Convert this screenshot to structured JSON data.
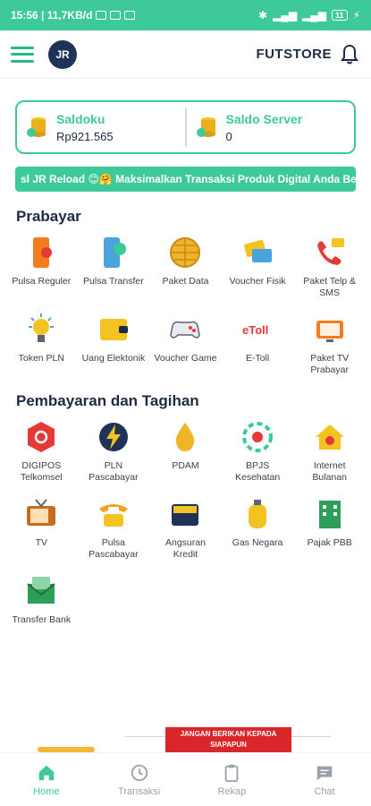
{
  "status": {
    "left": "15:56 | 11,7KB/d",
    "battery": "11"
  },
  "header": {
    "logo_text": "JR",
    "store_name": "FUTSTORE"
  },
  "balance": [
    {
      "label": "Saldoku",
      "value": "Rp921.565"
    },
    {
      "label": "Saldo Server",
      "value": "0"
    }
  ],
  "marquee": "sl JR Reload 😊🤗 Maksimalkan Transaksi Produk Digital Anda Bers",
  "prabayar": {
    "title": "Prabayar",
    "items": [
      {
        "label": "Pulsa Reguler"
      },
      {
        "label": "Pulsa Transfer"
      },
      {
        "label": "Paket Data"
      },
      {
        "label": "Voucher Fisik"
      },
      {
        "label": "Paket Telp & SMS"
      },
      {
        "label": "Token PLN"
      },
      {
        "label": "Uang Elektonik"
      },
      {
        "label": "Voucher Game"
      },
      {
        "label": "E-Toll"
      },
      {
        "label": "Paket TV Prabayar"
      }
    ]
  },
  "pembayaran": {
    "title": "Pembayaran dan Tagihan",
    "items": [
      {
        "label": "DIGIPOS Telkomsel"
      },
      {
        "label": "PLN Pascabayar"
      },
      {
        "label": "PDAM"
      },
      {
        "label": "BPJS Kesehatan"
      },
      {
        "label": "Internet Bulanan"
      },
      {
        "label": "TV"
      },
      {
        "label": "Pulsa Pascabayar"
      },
      {
        "label": "Angsuran Kredit"
      },
      {
        "label": "Gas Negara"
      },
      {
        "label": "Pajak PBB"
      },
      {
        "label": "Transfer Bank"
      }
    ]
  },
  "warning_banner": "JANGAN BERIKAN KEPADA SIAPAPUN",
  "nav": [
    {
      "label": "Home"
    },
    {
      "label": "Transaksi"
    },
    {
      "label": "Rekap"
    },
    {
      "label": "Chat"
    }
  ],
  "etoll_icon_text": "eToll",
  "colors": {
    "accent": "#3ec99a",
    "primary_text": "#1d2a44",
    "banner": "#d9262a"
  }
}
